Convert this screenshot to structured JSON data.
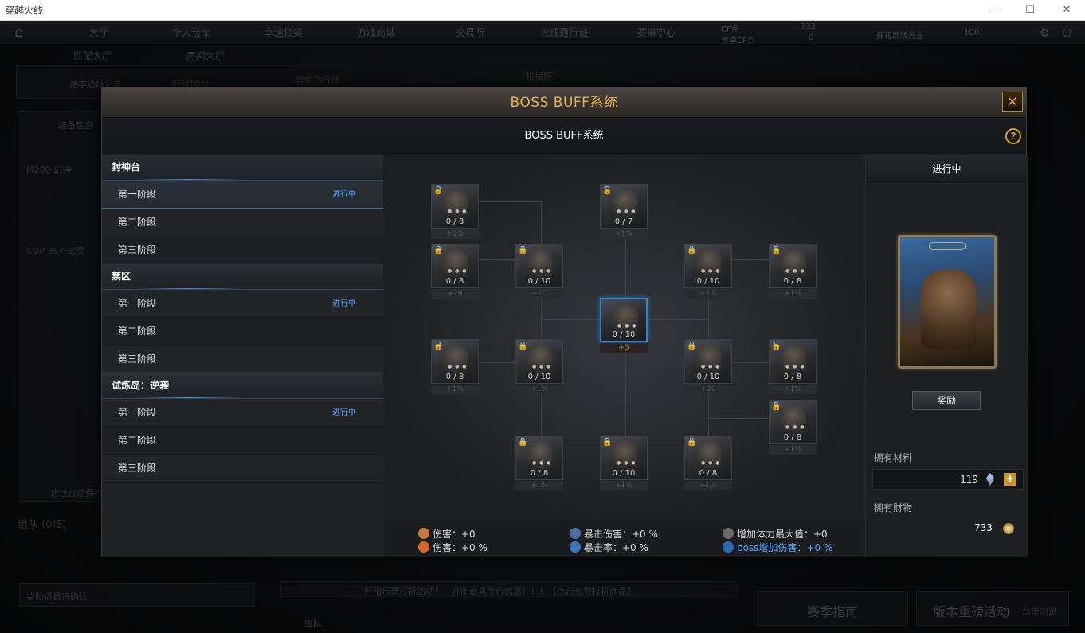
{
  "window": {
    "title": "穿越火线",
    "controls": [
      "—",
      "☐",
      "✕"
    ]
  },
  "topnav": {
    "tabs": [
      "大厅",
      "个人仓库",
      "幸运抽奖",
      "游戏商城",
      "交易所",
      "火线通行证",
      "赛事中心"
    ],
    "cf_label": "CF点",
    "cf_value": "733",
    "season_cf_label": "赛季CF点",
    "season_cf_value": "0",
    "username": "探花郎版先生",
    "level": "100"
  },
  "subnav": {
    "left": "匹配大厅",
    "right": "房间大厅"
  },
  "background": {
    "season_record": "赛季活跃记录",
    "time": "0分钟0秒",
    "fly_rank": "竞技飞行榜",
    "mech": "机械姬",
    "team": "组队 (0/5)",
    "loadout": "装备信息",
    "autosave": "背包自动保存",
    "notice": "开阳乐赛打折活动！！开阳道具半价优惠！！！【点击查看打折商品】",
    "season_guide": "赛季指南",
    "version_event": "版本重磅活动",
    "click_browse": "点击浏览",
    "team_label": "组队",
    "weapon1": "M200-幻神",
    "weapon2": "COP 357-幻灵",
    "equip_confirm": "奖励道具待确认"
  },
  "modal": {
    "title": "BOSS BUFF系统",
    "subtitle": "BOSS BUFF系统",
    "close": "✕",
    "help": "?",
    "categories": [
      {
        "name": "封神台",
        "stages": [
          {
            "name": "第一阶段",
            "status": "进行中"
          },
          {
            "name": "第二阶段",
            "status": ""
          },
          {
            "name": "第三阶段",
            "status": ""
          }
        ]
      },
      {
        "name": "禁区",
        "stages": [
          {
            "name": "第一阶段",
            "status": "进行中"
          },
          {
            "name": "第二阶段",
            "status": ""
          },
          {
            "name": "第三阶段",
            "status": ""
          }
        ]
      },
      {
        "name": "试炼岛：逆袭",
        "stages": [
          {
            "name": "第一阶段",
            "status": "进行中"
          },
          {
            "name": "第二阶段",
            "status": ""
          },
          {
            "name": "第三阶段",
            "status": ""
          }
        ]
      }
    ],
    "nodes": [
      {
        "progress": "0 / 8",
        "bonus": "+1%",
        "locked": true
      },
      {
        "progress": "0 / 7",
        "bonus": "+1%",
        "locked": true
      },
      {
        "progress": "0 / 8",
        "bonus": "+20",
        "locked": true
      },
      {
        "progress": "0 / 10",
        "bonus": "+20",
        "locked": true
      },
      {
        "progress": "0 / 10",
        "bonus": "+1%",
        "locked": true
      },
      {
        "progress": "0 / 8",
        "bonus": "+1%",
        "locked": true
      },
      {
        "progress": "0 / 10",
        "bonus": "+5",
        "locked": false
      },
      {
        "progress": "0 / 8",
        "bonus": "+1%",
        "locked": true
      },
      {
        "progress": "0 / 10",
        "bonus": "+1%",
        "locked": true
      },
      {
        "progress": "0 / 10",
        "bonus": "+20",
        "locked": true
      },
      {
        "progress": "0 / 8",
        "bonus": "+1%",
        "locked": true
      },
      {
        "progress": "0 / 8",
        "bonus": "+1%",
        "locked": true
      },
      {
        "progress": "0 / 8",
        "bonus": "+1%",
        "locked": true
      },
      {
        "progress": "0 / 10",
        "bonus": "+1%",
        "locked": true
      },
      {
        "progress": "0 / 8",
        "bonus": "+1%",
        "locked": true
      }
    ],
    "stats": {
      "damage": "伤害：+0",
      "damage_pct": "伤害：+0 %",
      "crit_damage": "暴击伤害：+0 %",
      "crit_rate": "暴击率：+0 %",
      "max_hp": "增加体力最大值：+0",
      "boss_damage": "boss增加伤害：+0 %"
    },
    "right": {
      "status": "进行中",
      "reward_button": "奖励",
      "materials_label": "拥有材料",
      "materials_value": "119",
      "wealth_label": "拥有财物",
      "wealth_value": "733"
    }
  },
  "colors": {
    "accent": "#e8b04b",
    "active_blue": "#4aa3ff",
    "bonus_orange": "#c47a3a"
  }
}
